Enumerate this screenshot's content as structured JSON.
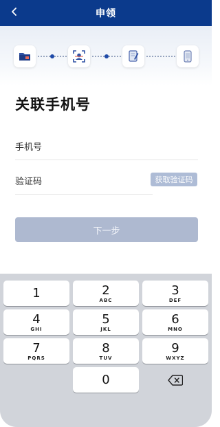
{
  "header": {
    "title": "申领",
    "back_icon": "chevron-left-icon",
    "background": "#0b3a8c"
  },
  "steps": [
    {
      "icon": "folder-icon",
      "active": true
    },
    {
      "icon": "face-scan-icon",
      "active": true
    },
    {
      "icon": "document-edit-icon",
      "active": false
    },
    {
      "icon": "phone-icon",
      "active": false
    }
  ],
  "page_title": "关联手机号",
  "form": {
    "phone_label": "手机号",
    "code_label": "验证码",
    "get_code_button": "获取验证码"
  },
  "next_button": "下一步",
  "keyboard": {
    "keys": [
      {
        "num": "1",
        "letters": ""
      },
      {
        "num": "2",
        "letters": "ABC"
      },
      {
        "num": "3",
        "letters": "DEF"
      },
      {
        "num": "4",
        "letters": "GHI"
      },
      {
        "num": "5",
        "letters": "JKL"
      },
      {
        "num": "6",
        "letters": "MNO"
      },
      {
        "num": "7",
        "letters": "PQRS"
      },
      {
        "num": "8",
        "letters": "TUV"
      },
      {
        "num": "9",
        "letters": "WXYZ"
      },
      {
        "num": "0",
        "letters": ""
      }
    ],
    "delete_icon": "backspace-icon"
  },
  "colors": {
    "primary": "#0b3a8c",
    "disabled_button": "#aeb9d0",
    "code_button": "#aebcd6"
  }
}
